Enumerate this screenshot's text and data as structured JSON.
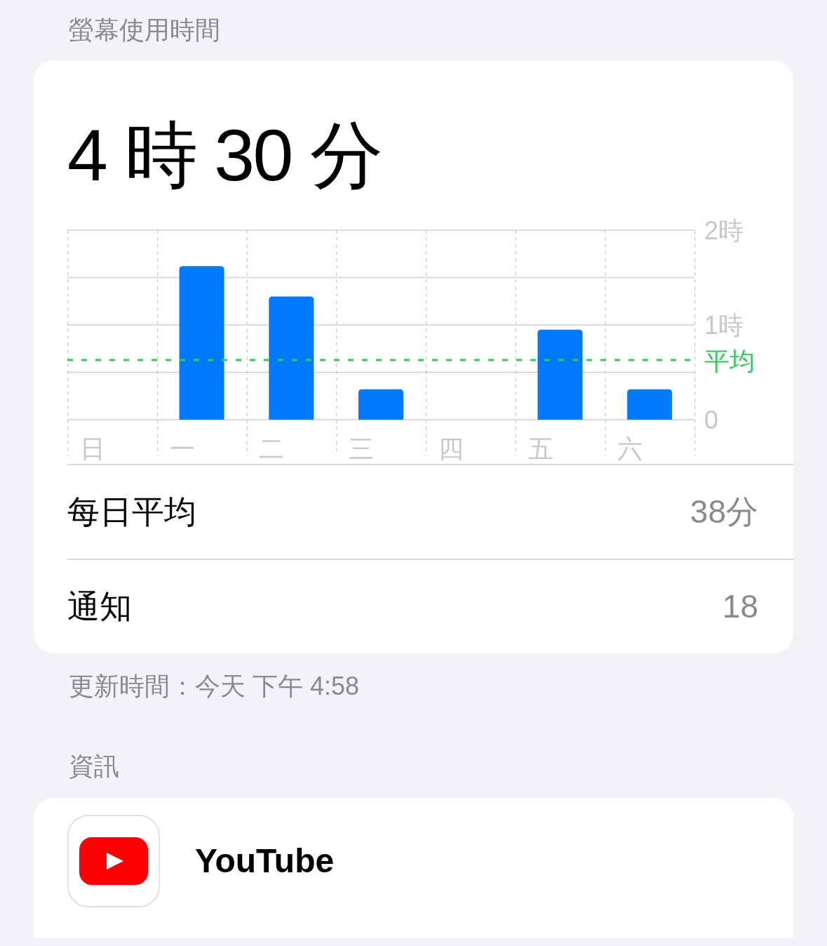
{
  "section_title": "螢幕使用時間",
  "summary": {
    "total": "4 時 30 分",
    "chart_data": {
      "type": "bar",
      "categories": [
        "日",
        "一",
        "二",
        "三",
        "四",
        "五",
        "六"
      ],
      "values": [
        0,
        1.62,
        1.3,
        0.32,
        0,
        0.95,
        0.32
      ],
      "ylim": [
        0,
        2
      ],
      "yticks": [
        0,
        {
          "value": 1,
          "label": "1時"
        },
        {
          "value": 2,
          "label": "2時"
        }
      ],
      "ref_lines": [
        {
          "axis": "y",
          "value": 0.63,
          "label": "平均",
          "color": "#34c759"
        }
      ]
    },
    "rows": [
      {
        "label": "每日平均",
        "value": "38分"
      },
      {
        "label": "通知",
        "value": "18"
      }
    ]
  },
  "updated": "更新時間：今天 下午 4:58",
  "info_title": "資訊",
  "apps": [
    {
      "name": "YouTube"
    }
  ]
}
